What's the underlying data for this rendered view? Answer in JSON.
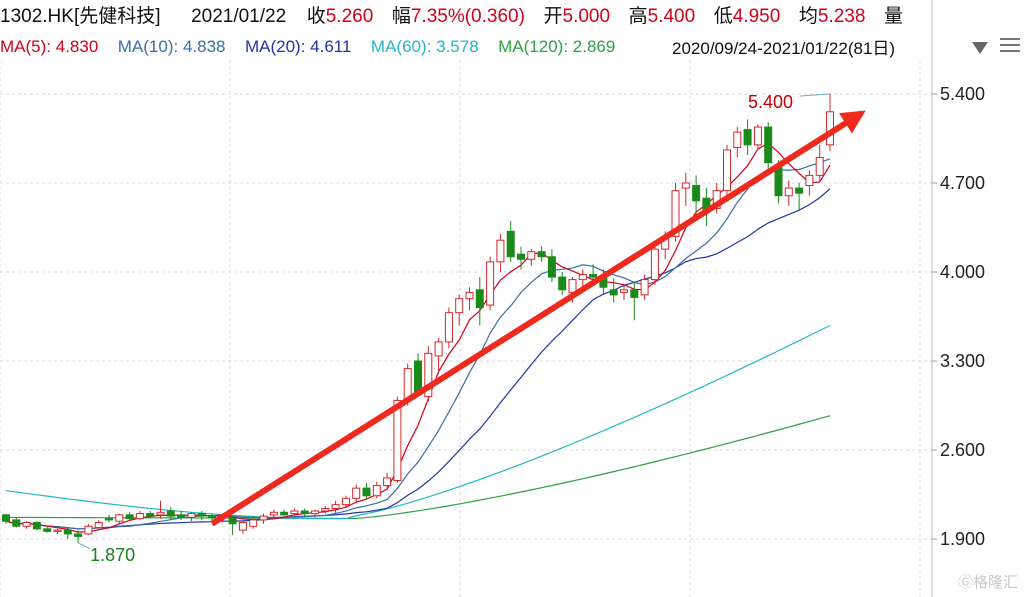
{
  "header": {
    "code": "1302.HK[先健科技]",
    "date": "2021/01/22",
    "close_label": "收",
    "close": "5.260",
    "change_label": "幅",
    "change": "7.35%(0.360)",
    "open_label": "开",
    "open": "5.000",
    "high_label": "高",
    "high": "5.400",
    "low_label": "低",
    "low": "4.950",
    "avg_label": "均",
    "avg": "5.238",
    "vol_label": "量"
  },
  "ma_legend": [
    {
      "label": "MA(5):",
      "value": "4.830",
      "color": "#d0021b"
    },
    {
      "label": "MA(10):",
      "value": "4.838",
      "color": "#3a6ea5"
    },
    {
      "label": "MA(20):",
      "value": "4.611",
      "color": "#1f35a8"
    },
    {
      "label": "MA(60):",
      "value": "3.578",
      "color": "#22b8c8"
    },
    {
      "label": "MA(120):",
      "value": "2.869",
      "color": "#2ea043"
    }
  ],
  "range_text": "2020/09/24-2021/01/22(81日)",
  "watermark": "格隆汇",
  "colors": {
    "up": "#d62728",
    "down": "#1a8a1a",
    "grid": "#d9d9d9",
    "arrow": "#ee2a1f"
  },
  "icons": [
    "dropdown-triangle-icon",
    "menu-icon"
  ],
  "chart_data": {
    "type": "candlestick",
    "ylim": [
      1.78,
      5.62
    ],
    "yticks": [
      "5.400",
      "4.700",
      "4.000",
      "3.300",
      "2.600",
      "1.900"
    ],
    "grid": true,
    "annotations": [
      {
        "text": "5.400",
        "kind": "max",
        "color": "#c00000"
      },
      {
        "text": "1.870",
        "kind": "min",
        "color": "#1a7f1a"
      }
    ],
    "arrow": {
      "from": [
        20,
        2.02
      ],
      "to": [
        79,
        5.25
      ]
    },
    "candles": [
      [
        2.09,
        2.1,
        2.02,
        2.04
      ],
      [
        2.05,
        2.07,
        1.99,
        2.0
      ],
      [
        2.0,
        2.04,
        1.98,
        2.03
      ],
      [
        2.03,
        2.04,
        1.97,
        1.98
      ],
      [
        1.98,
        2.0,
        1.95,
        1.96
      ],
      [
        1.96,
        1.98,
        1.94,
        1.97
      ],
      [
        1.97,
        1.99,
        1.9,
        1.94
      ],
      [
        1.94,
        1.97,
        1.87,
        1.92
      ],
      [
        1.94,
        2.02,
        1.93,
        2.0
      ],
      [
        1.99,
        2.05,
        1.97,
        2.03
      ],
      [
        2.06,
        2.09,
        2.03,
        2.05
      ],
      [
        2.04,
        2.1,
        2.02,
        2.09
      ],
      [
        2.09,
        2.11,
        2.05,
        2.06
      ],
      [
        2.06,
        2.12,
        2.05,
        2.1
      ],
      [
        2.1,
        2.12,
        2.06,
        2.08
      ],
      [
        2.09,
        2.2,
        2.06,
        2.11
      ],
      [
        2.12,
        2.15,
        2.05,
        2.08
      ],
      [
        2.09,
        2.12,
        2.05,
        2.07
      ],
      [
        2.07,
        2.11,
        2.04,
        2.1
      ],
      [
        2.1,
        2.12,
        2.05,
        2.08
      ],
      [
        2.08,
        2.1,
        2.04,
        2.07
      ],
      [
        2.07,
        2.1,
        2.03,
        2.09
      ],
      [
        2.06,
        2.08,
        1.93,
        2.02
      ],
      [
        1.97,
        2.04,
        1.94,
        2.03
      ],
      [
        2.0,
        2.08,
        1.98,
        2.05
      ],
      [
        2.05,
        2.1,
        2.02,
        2.08
      ],
      [
        2.09,
        2.13,
        2.06,
        2.11
      ],
      [
        2.11,
        2.13,
        2.08,
        2.09
      ],
      [
        2.1,
        2.14,
        2.08,
        2.12
      ],
      [
        2.12,
        2.14,
        2.08,
        2.1
      ],
      [
        2.1,
        2.13,
        2.07,
        2.12
      ],
      [
        2.12,
        2.16,
        2.1,
        2.14
      ],
      [
        2.14,
        2.2,
        2.1,
        2.17
      ],
      [
        2.17,
        2.24,
        2.15,
        2.22
      ],
      [
        2.22,
        2.33,
        2.18,
        2.3
      ],
      [
        2.3,
        2.34,
        2.22,
        2.24
      ],
      [
        2.24,
        2.35,
        2.22,
        2.32
      ],
      [
        2.32,
        2.42,
        2.3,
        2.38
      ],
      [
        2.36,
        3.02,
        2.34,
        2.99
      ],
      [
        2.99,
        3.28,
        2.95,
        3.24
      ],
      [
        3.3,
        3.36,
        3.02,
        3.04
      ],
      [
        3.02,
        3.42,
        2.98,
        3.36
      ],
      [
        3.34,
        3.48,
        3.2,
        3.45
      ],
      [
        3.45,
        3.72,
        3.4,
        3.68
      ],
      [
        3.68,
        3.82,
        3.58,
        3.79
      ],
      [
        3.79,
        3.88,
        3.7,
        3.84
      ],
      [
        3.86,
        3.96,
        3.58,
        3.72
      ],
      [
        3.74,
        4.12,
        3.7,
        4.08
      ],
      [
        4.08,
        4.3,
        4.0,
        4.25
      ],
      [
        4.32,
        4.4,
        4.08,
        4.12
      ],
      [
        4.14,
        4.2,
        4.02,
        4.1
      ],
      [
        4.1,
        4.18,
        4.05,
        4.16
      ],
      [
        4.16,
        4.2,
        4.08,
        4.12
      ],
      [
        4.12,
        4.18,
        3.92,
        3.96
      ],
      [
        3.96,
        4.0,
        3.82,
        3.86
      ],
      [
        3.84,
        3.96,
        3.76,
        3.94
      ],
      [
        3.94,
        4.02,
        3.86,
        3.98
      ],
      [
        3.98,
        4.06,
        3.9,
        3.96
      ],
      [
        3.96,
        4.02,
        3.82,
        3.88
      ],
      [
        3.86,
        3.95,
        3.76,
        3.82
      ],
      [
        3.84,
        3.9,
        3.78,
        3.86
      ],
      [
        3.86,
        3.92,
        3.62,
        3.8
      ],
      [
        3.82,
        3.98,
        3.78,
        3.94
      ],
      [
        3.94,
        4.22,
        3.9,
        4.18
      ],
      [
        4.18,
        4.32,
        4.1,
        4.28
      ],
      [
        4.28,
        4.7,
        4.24,
        4.64
      ],
      [
        4.66,
        4.78,
        4.52,
        4.7
      ],
      [
        4.68,
        4.76,
        4.42,
        4.56
      ],
      [
        4.58,
        4.66,
        4.36,
        4.48
      ],
      [
        4.5,
        4.7,
        4.46,
        4.64
      ],
      [
        4.64,
        5.0,
        4.6,
        4.96
      ],
      [
        4.98,
        5.14,
        4.9,
        5.1
      ],
      [
        5.12,
        5.2,
        4.92,
        5.0
      ],
      [
        5.0,
        5.16,
        4.96,
        5.14
      ],
      [
        5.14,
        5.18,
        4.78,
        4.86
      ],
      [
        4.82,
        4.88,
        4.54,
        4.6
      ],
      [
        4.6,
        4.72,
        4.52,
        4.66
      ],
      [
        4.66,
        4.7,
        4.48,
        4.62
      ],
      [
        4.68,
        4.8,
        4.6,
        4.76
      ],
      [
        4.76,
        5.0,
        4.72,
        4.9
      ],
      [
        5.0,
        5.4,
        4.95,
        5.26
      ]
    ]
  }
}
